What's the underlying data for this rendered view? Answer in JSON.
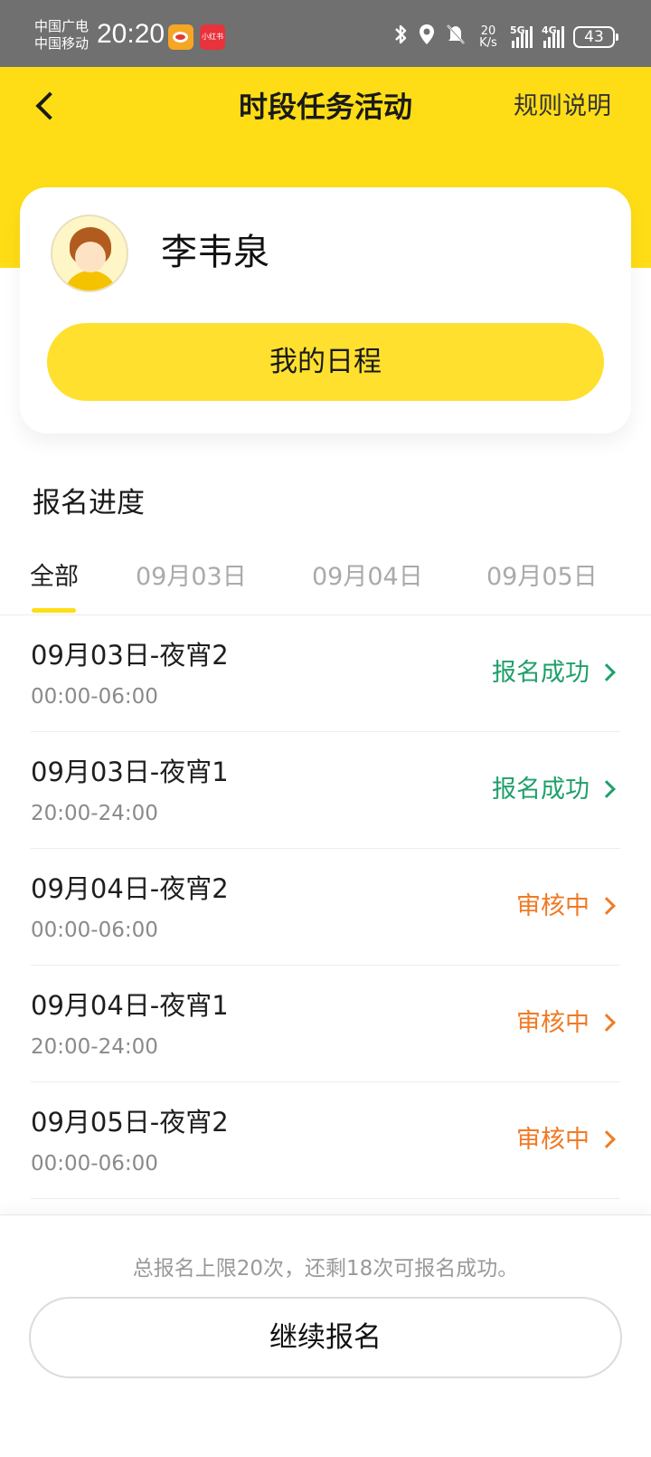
{
  "status_bar": {
    "carrier_1": "中国广电",
    "carrier_2": "中国移动",
    "time": "20:20",
    "net_speed_value": "20",
    "net_speed_unit": "K/s",
    "signal_1_label": "5G",
    "signal_2_label": "4G",
    "battery": "43",
    "red_app_label": "小红书"
  },
  "header": {
    "title": "时段任务活动",
    "rules_link": "规则说明",
    "accent_color": "#ffdd16"
  },
  "profile": {
    "name": "李韦泉",
    "schedule_button": "我的日程"
  },
  "progress": {
    "section_title": "报名进度",
    "tabs": [
      {
        "label": "全部",
        "active": true
      },
      {
        "label": "09月03日",
        "active": false
      },
      {
        "label": "09月04日",
        "active": false
      },
      {
        "label": "09月05日",
        "active": false
      }
    ],
    "items": [
      {
        "title": "09月03日-夜宵2",
        "time": "00:00-06:00",
        "status": "报名成功",
        "status_color": "#1fa06a"
      },
      {
        "title": "09月03日-夜宵1",
        "time": "20:00-24:00",
        "status": "报名成功",
        "status_color": "#1fa06a"
      },
      {
        "title": "09月04日-夜宵2",
        "time": "00:00-06:00",
        "status": "审核中",
        "status_color": "#f07a26"
      },
      {
        "title": "09月04日-夜宵1",
        "time": "20:00-24:00",
        "status": "审核中",
        "status_color": "#f07a26"
      },
      {
        "title": "09月05日-夜宵2",
        "time": "00:00-06:00",
        "status": "审核中",
        "status_color": "#f07a26"
      }
    ]
  },
  "bottom": {
    "quota_text": "总报名上限20次，还剩18次可报名成功。",
    "continue_button": "继续报名"
  }
}
